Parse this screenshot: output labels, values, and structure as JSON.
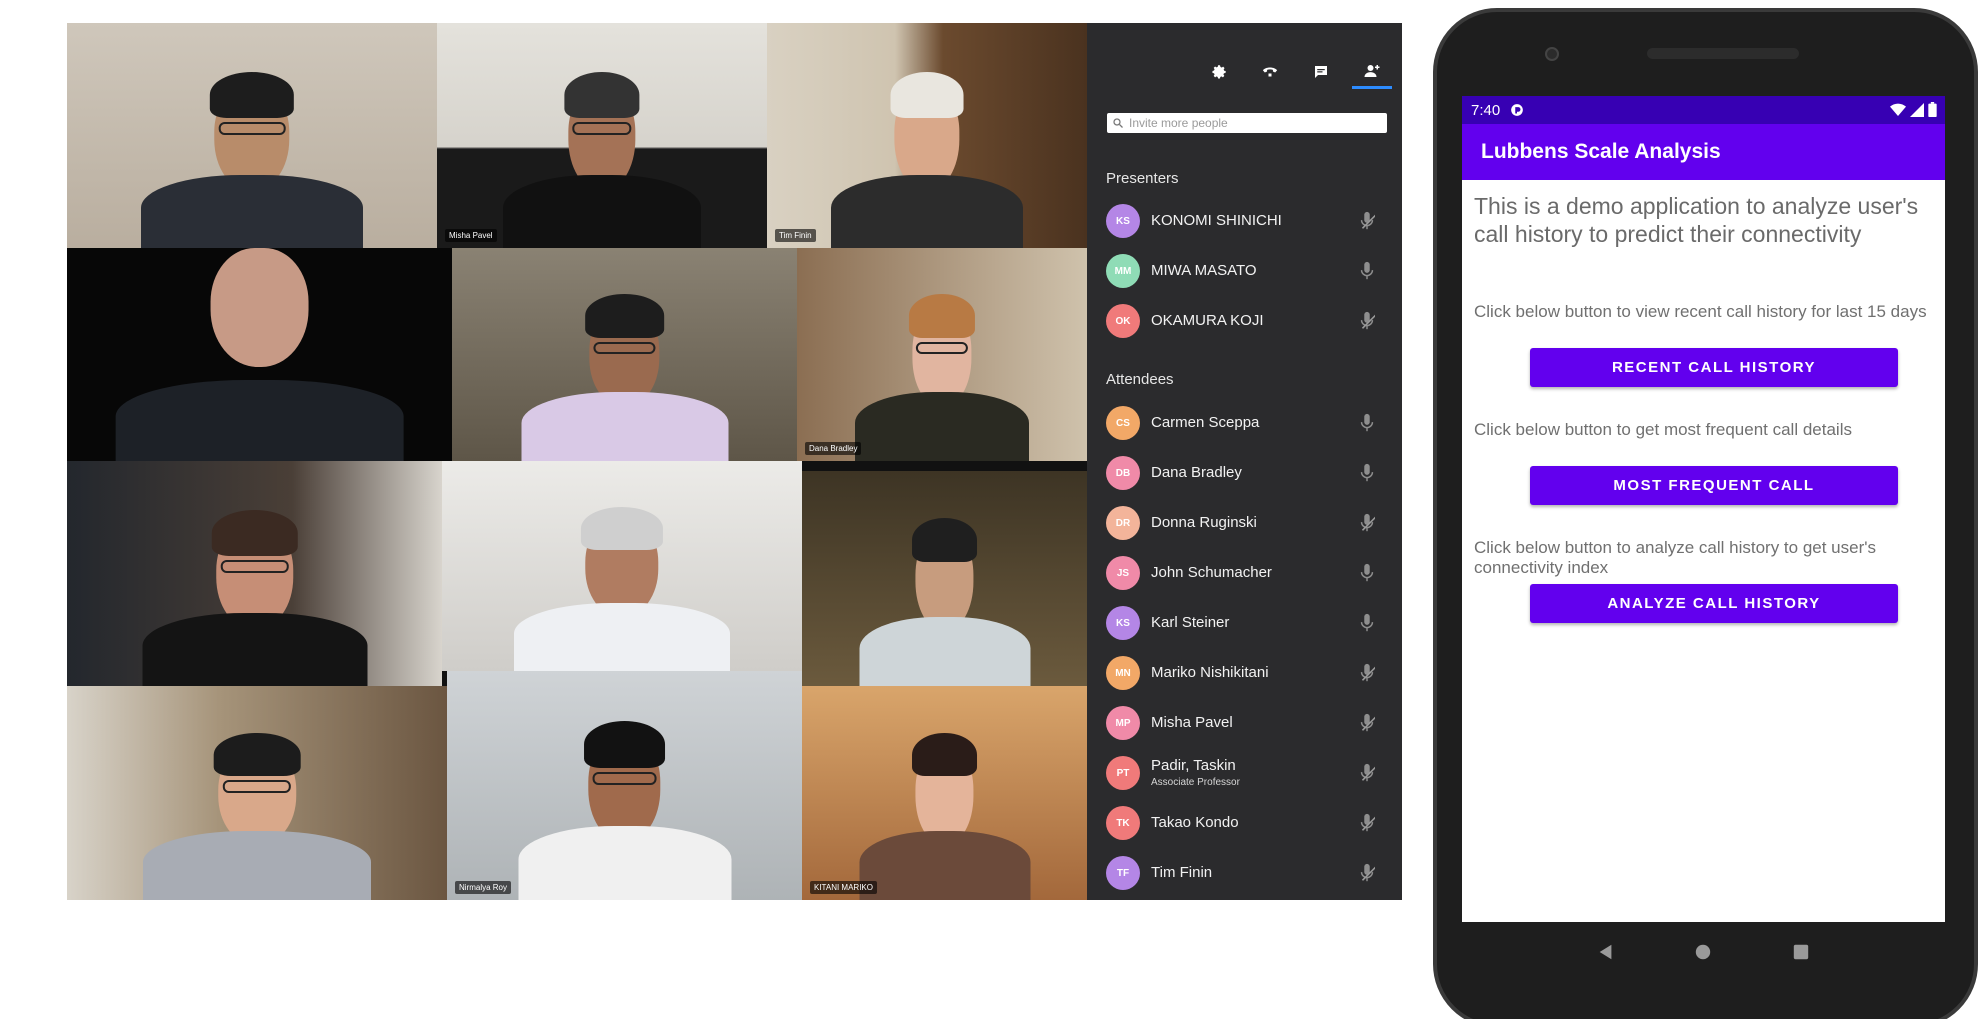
{
  "conference": {
    "tiles": [
      {
        "name": ""
      },
      {
        "name": "Misha Pavel"
      },
      {
        "name": "Tim Finin"
      },
      {
        "name": ""
      },
      {
        "name": ""
      },
      {
        "name": "Dana Bradley"
      },
      {
        "name": ""
      },
      {
        "name": ""
      },
      {
        "name": ""
      },
      {
        "name": ""
      },
      {
        "name": "Nirmalya Roy"
      },
      {
        "name": "KITANI MARIKO"
      }
    ],
    "panel": {
      "tabs": [
        {
          "icon": "settings-icon"
        },
        {
          "icon": "phone-icon"
        },
        {
          "icon": "chat-icon"
        },
        {
          "icon": "participants-icon",
          "active": true
        }
      ],
      "invite_placeholder": "Invite more people",
      "presenters_title": "Presenters",
      "attendees_title": "Attendees",
      "presenters": [
        {
          "initials": "KS",
          "name": "KONOMI SHINICHI",
          "color": "#b486e6",
          "muted": true
        },
        {
          "initials": "MM",
          "name": "MIWA MASATO",
          "color": "#8fdcb6",
          "muted": false
        },
        {
          "initials": "OK",
          "name": "OKAMURA KOJI",
          "color": "#f07a7a",
          "muted": true
        }
      ],
      "attendees": [
        {
          "initials": "CS",
          "name": "Carmen Sceppa",
          "color": "#f2a867",
          "muted": false
        },
        {
          "initials": "DB",
          "name": "Dana Bradley",
          "color": "#f08aa8",
          "muted": false
        },
        {
          "initials": "DR",
          "name": "Donna Ruginski",
          "color": "#f3b49a",
          "muted": true
        },
        {
          "initials": "JS",
          "name": "John Schumacher",
          "color": "#f08aa8",
          "muted": false
        },
        {
          "initials": "KS",
          "name": "Karl Steiner",
          "color": "#b486e6",
          "muted": false
        },
        {
          "initials": "MN",
          "name": "Mariko Nishikitani",
          "color": "#f2a867",
          "muted": true
        },
        {
          "initials": "MP",
          "name": "Misha Pavel",
          "color": "#f08aa8",
          "muted": true
        },
        {
          "initials": "PT",
          "name": "Padir, Taskin",
          "role": "Associate Professor",
          "color": "#f07a7a",
          "muted": true
        },
        {
          "initials": "TK",
          "name": "Takao Kondo",
          "color": "#f07a7a",
          "muted": true
        },
        {
          "initials": "TF",
          "name": "Tim Finin",
          "color": "#b486e6",
          "muted": true
        }
      ]
    }
  },
  "phone": {
    "status_time": "7:40",
    "app_title": "Lubbens Scale Analysis",
    "intro": "This is a demo application to analyze user's call history to predict their connectivity",
    "sections": [
      {
        "instruction": "Click below button to view recent call history for last 15 days",
        "button": "RECENT CALL HISTORY"
      },
      {
        "instruction": "Click below button to get most frequent call details",
        "button": "MOST FREQUENT CALL"
      },
      {
        "instruction": "Click below button to analyze call history to get user's connectivity index",
        "button": "ANALYZE CALL HISTORY"
      }
    ],
    "colors": {
      "primary": "#6200ee",
      "status_bar": "#3700b3"
    }
  }
}
